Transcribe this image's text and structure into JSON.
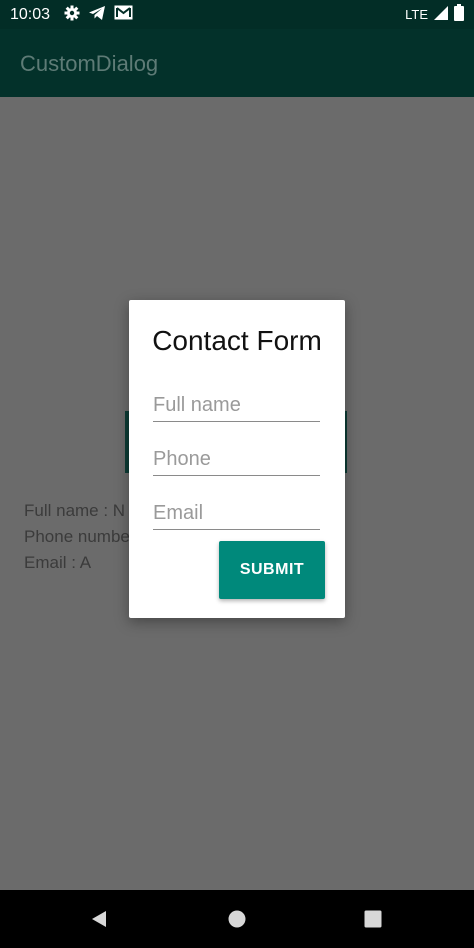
{
  "status_bar": {
    "time": "10:03",
    "left_icons": [
      "gear-icon",
      "telegram-icon",
      "gmail-icon"
    ],
    "network": "LTE",
    "right_icons": [
      "signal-icon",
      "battery-icon"
    ]
  },
  "app_bar": {
    "title": "CustomDialog"
  },
  "background": {
    "result_lines": [
      "Full name : N",
      "Phone numbe",
      "Email : A"
    ]
  },
  "dialog": {
    "title": "Contact Form",
    "fields": [
      {
        "placeholder": "Full name",
        "value": ""
      },
      {
        "placeholder": "Phone",
        "value": ""
      },
      {
        "placeholder": "Email",
        "value": ""
      }
    ],
    "submit_label": "SUBMIT"
  },
  "navigation": {
    "buttons": [
      "back-icon",
      "home-icon",
      "recents-icon"
    ]
  },
  "colors": {
    "primary_dark": "#022d26",
    "primary": "#03312a",
    "accent": "#00897b",
    "scrim": "#6b6b6b"
  }
}
